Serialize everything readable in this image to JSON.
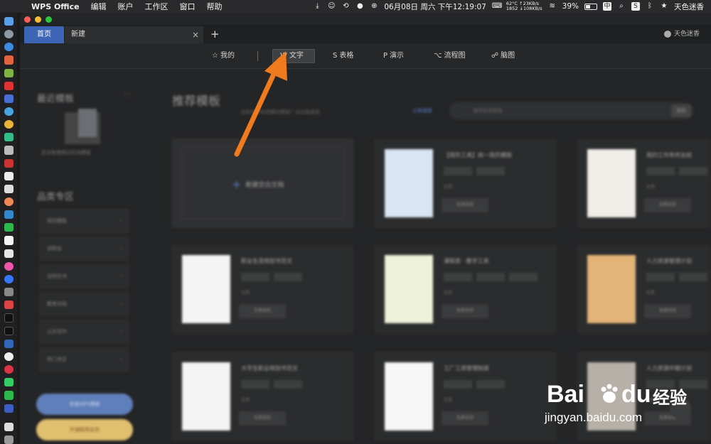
{
  "menubar": {
    "app_name": "WPS Office",
    "menus": [
      "编辑",
      "账户",
      "工作区",
      "窗口",
      "帮助"
    ],
    "date_time": "06月08日 周六 下午12:19:07",
    "temp_cpu": "62°C",
    "net_up": "↑23KB/s",
    "net_rpm": "1852",
    "net_down": "↓108KB/s",
    "battery": "39%",
    "user_name": "天色迷香"
  },
  "tabs": {
    "home": "首页",
    "new": "新建",
    "close": "×",
    "add": "+",
    "user": "天色迷香"
  },
  "subnav": {
    "mine": "我的",
    "text": "文字",
    "sheet": "表格",
    "present": "演示",
    "flow": "流程图",
    "mind": "脑图"
  },
  "sidebar": {
    "recent_title": "最近模板",
    "recent_caption": "还没有使用过任何模板",
    "category_title": "品类专区",
    "items": [
      "简历模板",
      "求职信",
      "合同文书",
      "教育文档",
      "公文写作",
      "热门专区"
    ],
    "btn_blue": "安装WPS模板",
    "btn_yellow": "开通稻壳会员"
  },
  "main": {
    "title": "推荐模板",
    "subtitle": "没有找到你想要的模板？试试看搜索",
    "link": "立即搜索",
    "search_placeholder": "搜索稻壳模板",
    "search_btn": "搜索",
    "blank": "新建空白文档",
    "cards": [
      {
        "title": "【简历工具】统一简历模版",
        "meta": "免费",
        "btn": "免费使用"
      },
      {
        "title": "简约工作年终总结",
        "meta": "免费",
        "btn": "免费使用"
      },
      {
        "title": "职业生涯规划书范文",
        "meta": "免费",
        "btn": "免费使用"
      },
      {
        "title": "课程表 · 教学工具",
        "meta": "免费",
        "btn": "免费使用"
      },
      {
        "title": "人力资源管理计划",
        "meta": "免费",
        "btn": "免费使用"
      },
      {
        "title": "大学生职业规划书范文",
        "meta": "免费",
        "btn": "免费使用"
      },
      {
        "title": "工厂工资管理制度",
        "meta": "免费",
        "btn": "免费使用"
      },
      {
        "title": "人力资源中期计划",
        "meta": "免费",
        "btn": "免费使用"
      }
    ]
  },
  "watermark": {
    "bai": "Bai",
    "du": "du",
    "jingyan": "经验",
    "url": "jingyan.baidu.com"
  },
  "colors": {
    "accent_blue": "#3c66b5",
    "arrow_orange": "#f07a1e",
    "button_yellow": "#e0c06f"
  }
}
